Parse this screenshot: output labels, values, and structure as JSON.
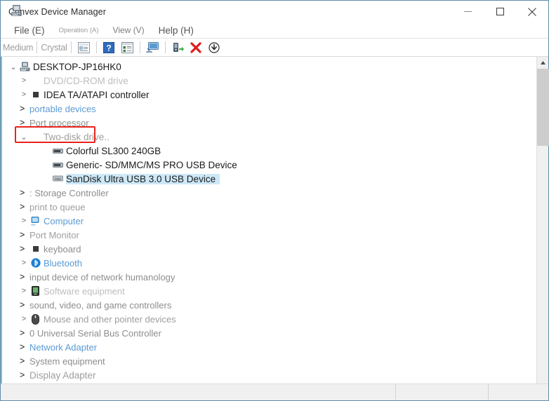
{
  "window": {
    "title": "Convex Device Manager",
    "icon": "computer-icon",
    "controls": {
      "minimize": "—",
      "maximize": "□",
      "close": "✕"
    }
  },
  "menubar": {
    "items": [
      {
        "label": "File (E)",
        "style": "normal"
      },
      {
        "label": "Operation (A)",
        "style": "dim"
      },
      {
        "label": "View (V)",
        "style": "mid"
      },
      {
        "label": "Help (H)",
        "style": "normal"
      }
    ]
  },
  "toolbar": {
    "ghost_labels": [
      "Medium",
      "Crystal"
    ],
    "buttons": [
      {
        "name": "properties-button",
        "icon": "properties-icon"
      },
      {
        "name": "help-button",
        "icon": "question-mark-icon"
      },
      {
        "name": "details-view-button",
        "icon": "list-details-icon"
      },
      {
        "name": "scan-hardware-button",
        "icon": "monitor-scan-icon"
      },
      {
        "name": "update-driver-button",
        "icon": "update-driver-icon"
      },
      {
        "name": "uninstall-button",
        "icon": "red-x-icon"
      },
      {
        "name": "download-button",
        "icon": "download-arrow-icon"
      }
    ]
  },
  "tree": {
    "root": {
      "label": "DESKTOP-JP16HK0",
      "twisty": "⌄",
      "icon": "computer-tower-icon"
    },
    "nodes": [
      {
        "label": "DVD/CD-ROM drive",
        "twisty": ">",
        "icon": "none",
        "level": 1,
        "style": "fade",
        "size": "big"
      },
      {
        "label": "IDEA TA/ATAPI controller",
        "twisty": ">",
        "icon": "square-icon",
        "level": 1,
        "style": "dark",
        "size": "big"
      },
      {
        "label": "portable devices",
        "twisty": ">",
        "icon": "none",
        "level": 1,
        "style": "blue",
        "size": "sm",
        "plain": true
      },
      {
        "label": "Port processor",
        "twisty": ">",
        "icon": "none",
        "level": 1,
        "style": "gray",
        "size": "sm",
        "plain": true
      },
      {
        "label": "Two-disk drive..",
        "twisty": "⌄",
        "icon": "none",
        "level": 1,
        "style": "fade2",
        "size": "big",
        "highlight": true
      },
      {
        "label": "Colorful SL300 240GB",
        "twisty": "",
        "icon": "disk-icon",
        "level": 2,
        "style": "dark",
        "size": "big"
      },
      {
        "label": "Generic- SD/MMC/MS PRO USB Device",
        "twisty": "",
        "icon": "disk-icon",
        "level": 2,
        "style": "dark",
        "size": "big"
      },
      {
        "label": "SanDisk Ultra USB 3.0 USB Device",
        "twisty": "",
        "icon": "disk-sel-icon",
        "level": 2,
        "style": "dark",
        "size": "big",
        "selected": true
      },
      {
        "label": ": Storage Controller",
        "twisty": ">",
        "icon": "none",
        "level": 1,
        "style": "gray",
        "size": "sm",
        "plain": true
      },
      {
        "label": "print to queue",
        "twisty": ">",
        "icon": "none",
        "level": 1,
        "style": "fade2",
        "size": "sm",
        "plain": true
      },
      {
        "label": "Computer",
        "twisty": ">",
        "icon": "monitor-icon",
        "level": 1,
        "style": "blue",
        "size": "sm"
      },
      {
        "label": "Port Monitor",
        "twisty": ">",
        "icon": "none",
        "level": 1,
        "style": "fade2",
        "size": "sm",
        "plain": true
      },
      {
        "label": "keyboard",
        "twisty": ">",
        "icon": "square-icon",
        "level": 1,
        "style": "gray",
        "size": "sm",
        "plain": true
      },
      {
        "label": "Bluetooth",
        "twisty": ">",
        "icon": "bluetooth-icon",
        "level": 1,
        "style": "blue",
        "size": "sm"
      },
      {
        "label": "input device of network humanology",
        "twisty": ">",
        "icon": "none",
        "level": 1,
        "style": "gray",
        "size": "sm",
        "plain": true
      },
      {
        "label": "Software equipment",
        "twisty": ">",
        "icon": "device-icon",
        "level": 1,
        "style": "fade",
        "size": "sm"
      },
      {
        "label": "sound, video, and game controllers",
        "twisty": ">",
        "icon": "none",
        "level": 1,
        "style": "gray",
        "size": "sm",
        "plain": true
      },
      {
        "label": "Mouse and other pointer devices",
        "twisty": ">",
        "icon": "mouse-icon",
        "level": 1,
        "style": "fade2",
        "size": "sm"
      },
      {
        "label": "0 Universal Serial Bus Controller",
        "twisty": ">",
        "icon": "none",
        "level": 1,
        "style": "gray",
        "size": "sm",
        "plain": true
      },
      {
        "label": "Network Adapter",
        "twisty": ">",
        "icon": "none",
        "level": 1,
        "style": "blue",
        "size": "sm",
        "plain": true
      },
      {
        "label": "System equipment",
        "twisty": ">",
        "icon": "none",
        "level": 1,
        "style": "gray",
        "size": "sm",
        "plain": true
      },
      {
        "label": "Display Adapter",
        "twisty": ">",
        "icon": "none",
        "level": 1,
        "style": "fade2",
        "size": "big",
        "plain": true
      }
    ]
  },
  "scrollbar": {
    "up_arrow": "▲",
    "down_arrow": "▼"
  },
  "statusbar": {
    "cell1": "",
    "cell2": "",
    "cell3": ""
  },
  "colors": {
    "accent_blue": "#5b9bd5",
    "selection": "#cde8f7",
    "annotation_red": "#e8231d",
    "window_border": "#5b8fa8"
  }
}
